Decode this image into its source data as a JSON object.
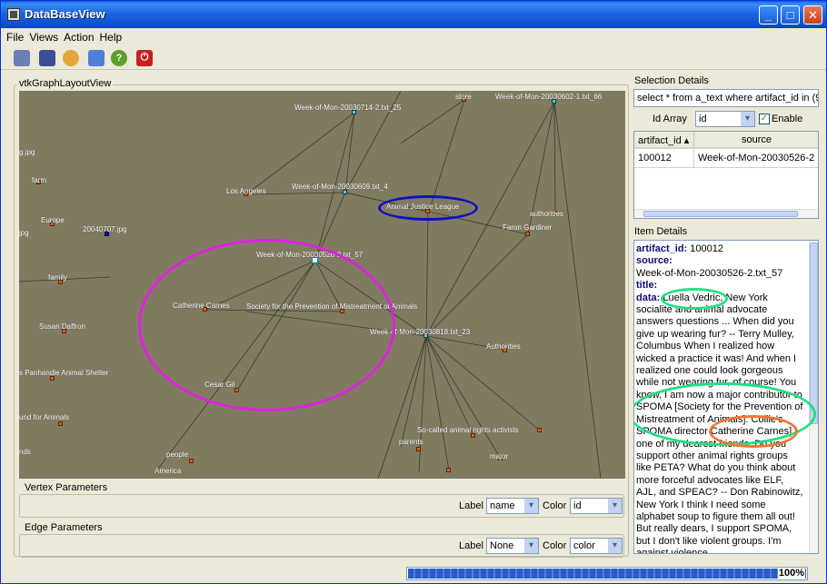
{
  "window": {
    "title": "DataBaseView",
    "minimize": "_",
    "maximize": "□",
    "close": "✕"
  },
  "menu": [
    "File",
    "Views",
    "Action",
    "Help"
  ],
  "toolbar": [
    {
      "name": "database-icon",
      "color": "#6a7fb4"
    },
    {
      "name": "save-icon",
      "color": "#3c4e9a"
    },
    {
      "name": "open-icon",
      "color": "#e2a83c"
    },
    {
      "name": "query-icon",
      "color": "#4f7fd8"
    },
    {
      "name": "help-icon",
      "color": "#5aa02c"
    },
    {
      "name": "power-icon",
      "color": "#c82020"
    }
  ],
  "graph_view": {
    "label": "vtkGraphLayoutView",
    "labels": {
      "store": "store",
      "w0714": "Week-of-Mon-20030714-2.txt_25",
      "w0602": "Week-of-Mon-20030602-1.txt_66",
      "jpg1": "g.jpg",
      "farm": "farm",
      "la": "Los Angeles",
      "w0609": "Week-of-Mon-20030609.txt_4",
      "ajl": "Animal Justice League",
      "authorities1": "authorities",
      "europe": "Europe",
      "jpg2": "20040707.jpg",
      "faron": "Faron Gardiner",
      "jpg3": "jpg",
      "w0526": "Week-of-Mon-20030526-2.txt_57",
      "family": "family",
      "catherine": "Catherine Carnes",
      "spoma": "Society for the Prevention of Mistreatment  of Animals",
      "susan": "Susan Daffron",
      "w0818": "Week-of-Mon-20030818.txt_23",
      "authorities2": "Authorities",
      "panhandle": "s Panhandle Animal Shelter",
      "cesar": "Cesar Gil",
      "fund": "und for Animals",
      "activists": "So-called animal rights activists",
      "parents": "parents",
      "nds": "nds",
      "people": "people",
      "major": "major",
      "america": "America"
    }
  },
  "vertex_params": {
    "label": "Vertex Parameters",
    "label_caption": "Label",
    "label_value": "name",
    "color_caption": "Color",
    "color_value": "id"
  },
  "edge_params": {
    "label": "Edge Parameters",
    "label_caption": "Label",
    "label_value": "None",
    "color_caption": "Color",
    "color_value": "color"
  },
  "selection": {
    "label": "Selection Details",
    "query": "select * from a_text where artifact_id in (9",
    "id_array_caption": "Id Array",
    "id_array_value": "id",
    "enable_label": "Enable",
    "enable_checked": "✓",
    "columns": [
      "artifact_id ▴",
      "source"
    ],
    "rows": [
      [
        "100012",
        "Week-of-Mon-20030526-2"
      ]
    ]
  },
  "item_details": {
    "label": "Item Details",
    "artifact_key": "artifact_id:",
    "artifact_val": " 100012",
    "source_key": "source:",
    "source_val": "Week-of-Mon-20030526-2.txt_57",
    "title_key": "title:",
    "data_key": "data:",
    "data_val": " Luella Vedric, New York socialite and animal advocate answers questions ... When did you give up wearing fur? -- Terry Mulley, Columbus When I realized how wicked a practice it was! And when I realized one could look gorgeous while not wearing fur, of course! You know, I am now a major contributor to SPOMA [Society for the Prevention of Mistreatment of Animals]. Collie's SPOMA director Catherine Carnes] one of my dearest friends. Do you support other animal rights groups like PETA? What do you think about more forceful advocates like ELF, AJL, and SPEAC? -- Don Rabinowitz, New York I think I need some alphabet soup to figure them all out! But really dears, I support SPOMA, but I don't like violent groups. I'm against violence"
  },
  "progress": {
    "value": 1.0,
    "text": "100%"
  },
  "colors": {
    "annotation_magenta": "#e020e0",
    "annotation_blue": "#1010c0",
    "annotation_green": "#20e080",
    "annotation_orange": "#f07830"
  }
}
